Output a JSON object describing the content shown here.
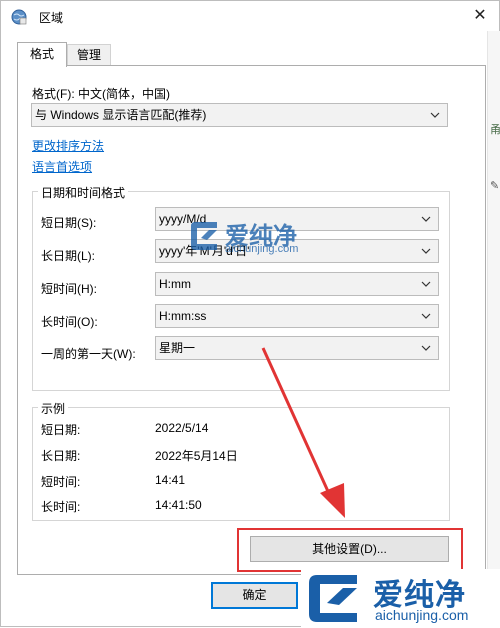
{
  "window": {
    "title": "区域"
  },
  "tabs": [
    {
      "label": "格式"
    },
    {
      "label": "管理"
    }
  ],
  "format": {
    "label": "格式(F): 中文(简体，中国)",
    "value": "与 Windows 显示语言匹配(推荐)"
  },
  "links": {
    "sort": "更改排序方法",
    "lang_pref": "语言首选项"
  },
  "datetime_group": {
    "title": "日期和时间格式",
    "rows": [
      {
        "label": "短日期(S):",
        "value": "yyyy/M/d"
      },
      {
        "label": "长日期(L):",
        "value": "yyyy'年'M'月'd'日'"
      },
      {
        "label": "短时间(H):",
        "value": "H:mm"
      },
      {
        "label": "长时间(O):",
        "value": "H:mm:ss"
      },
      {
        "label": "一周的第一天(W):",
        "value": "星期一"
      }
    ]
  },
  "example_group": {
    "title": "示例",
    "rows": [
      {
        "label": "短日期:",
        "value": "2022/5/14"
      },
      {
        "label": "长日期:",
        "value": "2022年5月14日"
      },
      {
        "label": "短时间:",
        "value": "14:41"
      },
      {
        "label": "长时间:",
        "value": "14:41:50"
      }
    ]
  },
  "buttons": {
    "more_settings": "其他设置(D)...",
    "ok": "确定"
  },
  "watermark": {
    "text": "爱纯净",
    "url": "aichunjing.com"
  },
  "colors": {
    "accent": "#0078d7",
    "link": "#0066cc",
    "highlight_red": "#e13434"
  }
}
